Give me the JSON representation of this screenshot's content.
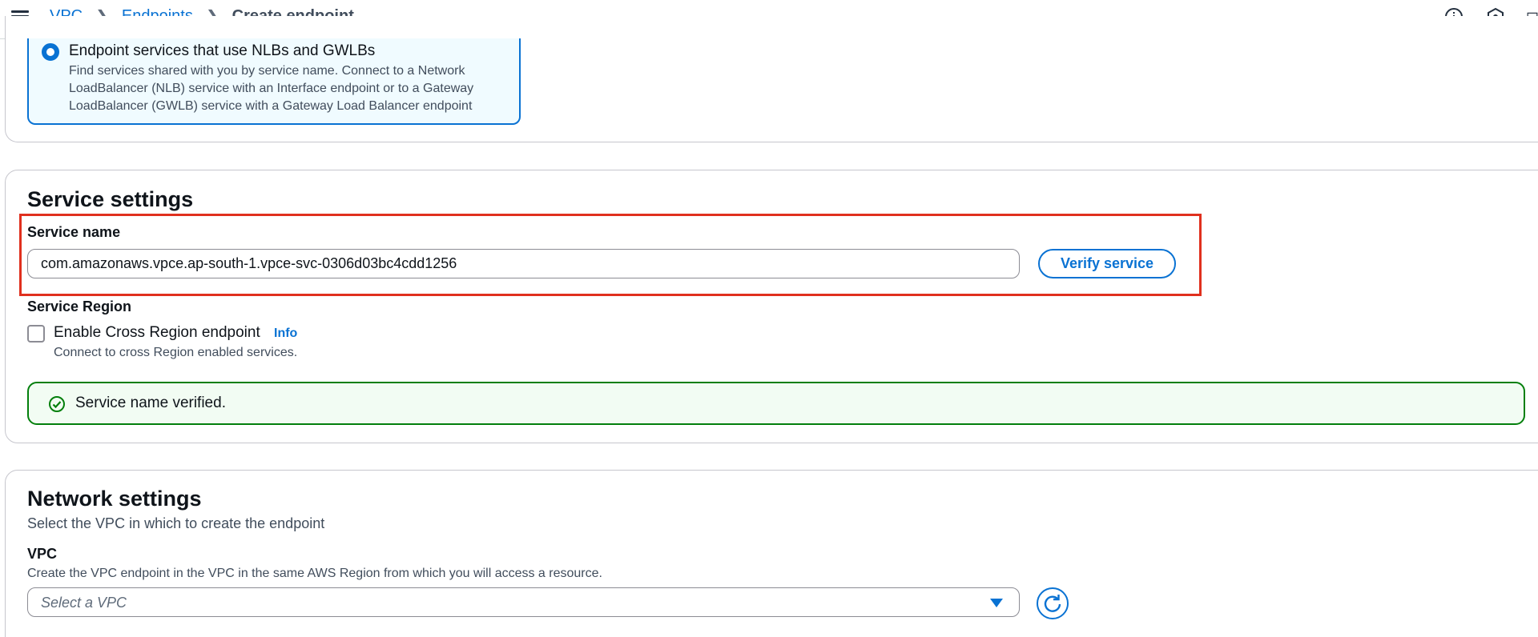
{
  "topbar": {
    "breadcrumb": [
      {
        "label": "VPC"
      },
      {
        "label": "Endpoints"
      },
      {
        "label": "Create endpoint"
      }
    ],
    "icons": [
      "info-icon",
      "hexagon-icon",
      "screen-icon"
    ]
  },
  "service_category": {
    "selected_option": {
      "title": "Endpoint services that use NLBs and GWLBs",
      "description": "Find services shared with you by service name. Connect to a Network LoadBalancer (NLB) service with an Interface endpoint or to a Gateway LoadBalancer (GWLB) service with a Gateway Load Balancer endpoint"
    }
  },
  "service_settings": {
    "title": "Service settings",
    "service_name_label": "Service name",
    "service_name_value": "com.amazonaws.vpce.ap-south-1.vpce-svc-0306d03bc4cdd1256",
    "verify_button": "Verify service",
    "region_label": "Service Region",
    "cross_region_label": "Enable Cross Region endpoint",
    "cross_region_checked": false,
    "info_link": "Info",
    "cross_region_desc": "Connect to cross Region enabled services.",
    "success_message": "Service name verified."
  },
  "network_settings": {
    "title": "Network settings",
    "subtitle": "Select the VPC in which to create the endpoint",
    "vpc_label": "VPC",
    "vpc_desc": "Create the VPC endpoint in the VPC in the same AWS Region from which you will access a resource.",
    "vpc_placeholder": "Select a VPC"
  },
  "colors": {
    "accent": "#0972d3",
    "success": "#037f0c",
    "highlight": "#e0301e"
  }
}
